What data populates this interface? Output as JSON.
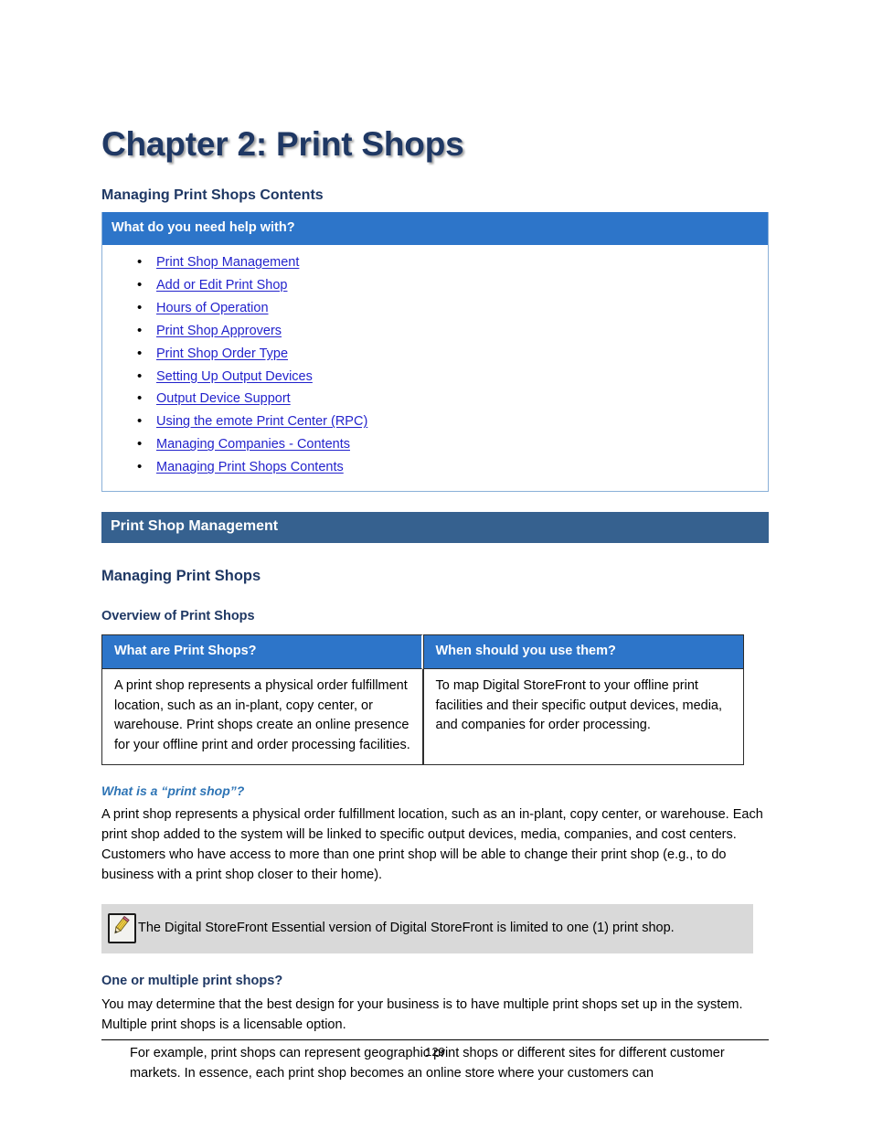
{
  "document": {
    "chapter_title": "Chapter 2: Print Shops",
    "page_number": "129"
  },
  "contents_section": {
    "heading": "Managing Print Shops Contents",
    "box_header": "What do you need help with?",
    "links": [
      "Print Shop Management",
      "Add or Edit Print Shop",
      "Hours of Operation",
      "Print Shop Approvers",
      "Print Shop Order Type",
      "Setting Up Output Devices",
      "Output Device Support",
      "Using the emote Print Center (RPC)",
      "Managing Companies - Contents",
      "Managing Print Shops Contents"
    ]
  },
  "management_section": {
    "band_title": "Print Shop Management",
    "heading": "Managing Print Shops",
    "subheading": "Overview of Print Shops",
    "table": {
      "headers": [
        "What are Print Shops?",
        "When should you use them?"
      ],
      "row": [
        "A print shop represents a physical order fulfillment location, such as an in-plant, copy center, or warehouse. Print shops create an online presence for your offline print and order processing facilities.",
        "To map Digital StoreFront to your offline print facilities and their specific output devices, media, and companies for order processing."
      ]
    },
    "what_is_heading": "What is a “print shop”?",
    "what_is_body": "A print shop represents a physical order fulfillment location, such as an in-plant, copy center, or warehouse. Each print shop added to the system will be linked to specific output devices, media, companies, and cost centers. Customers who have access to more than one print shop will be able to change their print shop (e.g., to do business with a print shop closer to their home).",
    "note": {
      "icon": "pencil-icon",
      "text": "The Digital StoreFront Essential version of Digital StoreFront is limited to one (1) print shop."
    },
    "multiple_heading": "One or multiple print shops?",
    "multiple_body": "You may determine that the best design for your business is to have multiple print shops set up in the system. Multiple print shops is a licensable option.",
    "example_body": "For example, print shops can represent geographic print shops or different sites for different customer markets. In essence, each print shop becomes an online store where your customers can"
  },
  "colors": {
    "title_navy": "#1f3864",
    "band_blue": "#36618f",
    "header_blue": "#2d75c9",
    "link_blue": "#2323cc",
    "italic_blue": "#2e74b5",
    "note_gray": "#d9d9d9"
  }
}
